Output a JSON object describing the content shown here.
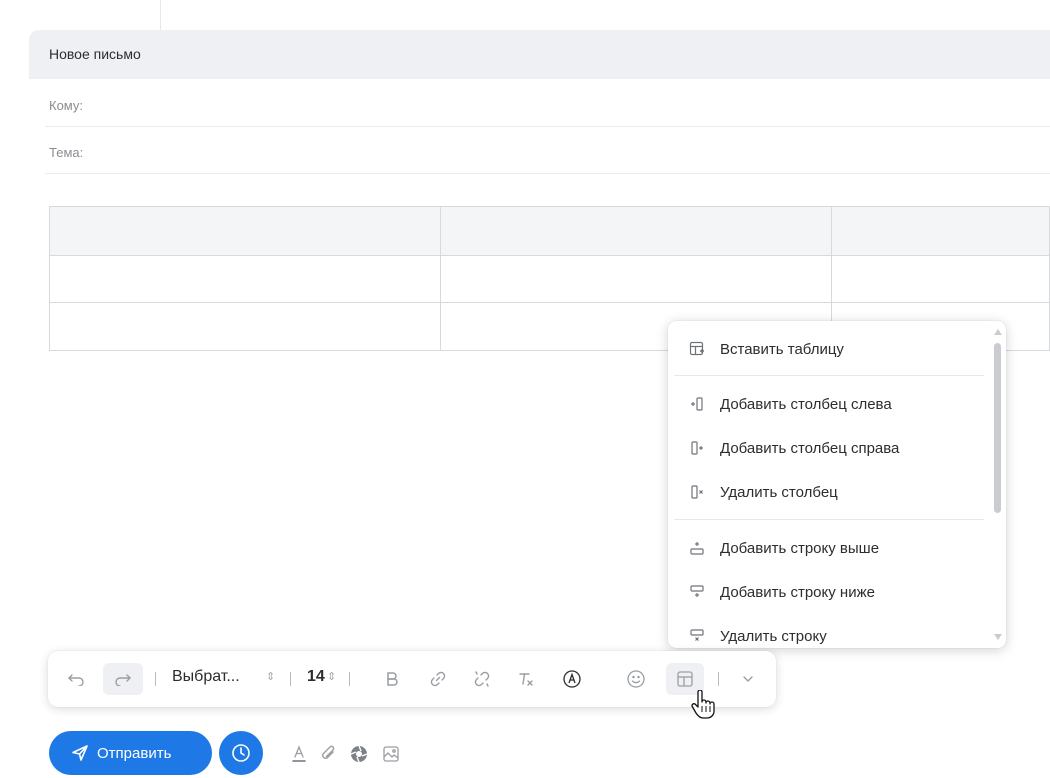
{
  "compose": {
    "title": "Новое письмо",
    "to_label": "Кому:",
    "subject_label": "Тема:"
  },
  "table_menu": {
    "items": [
      {
        "label": "Вставить таблицу",
        "icon": "insert-table-icon"
      },
      {
        "label": "Добавить столбец слева",
        "icon": "add-column-left-icon"
      },
      {
        "label": "Добавить столбец справа",
        "icon": "add-column-right-icon"
      },
      {
        "label": "Удалить столбец",
        "icon": "delete-column-icon"
      },
      {
        "label": "Добавить строку выше",
        "icon": "add-row-above-icon"
      },
      {
        "label": "Добавить строку ниже",
        "icon": "add-row-below-icon"
      },
      {
        "label": "Удалить строку",
        "icon": "delete-row-icon"
      }
    ]
  },
  "toolbar": {
    "font_value": "Выбрат...",
    "size_value": "14",
    "icons": [
      "undo-icon",
      "redo-icon",
      "bold-icon",
      "link-icon",
      "unlink-icon",
      "clear-format-icon",
      "signature-icon",
      "emoji-icon",
      "table-icon",
      "chevron-down-icon"
    ]
  },
  "actions": {
    "send_label": "Отправить",
    "icons": [
      "send-icon",
      "clock-icon",
      "text-color-icon",
      "paperclip-icon",
      "cloud-icon",
      "image-icon"
    ]
  },
  "colors": {
    "accent": "#1e78e6",
    "header_bg": "#eef0f3",
    "text": "#2c2d2e",
    "muted": "#8a8d91"
  }
}
